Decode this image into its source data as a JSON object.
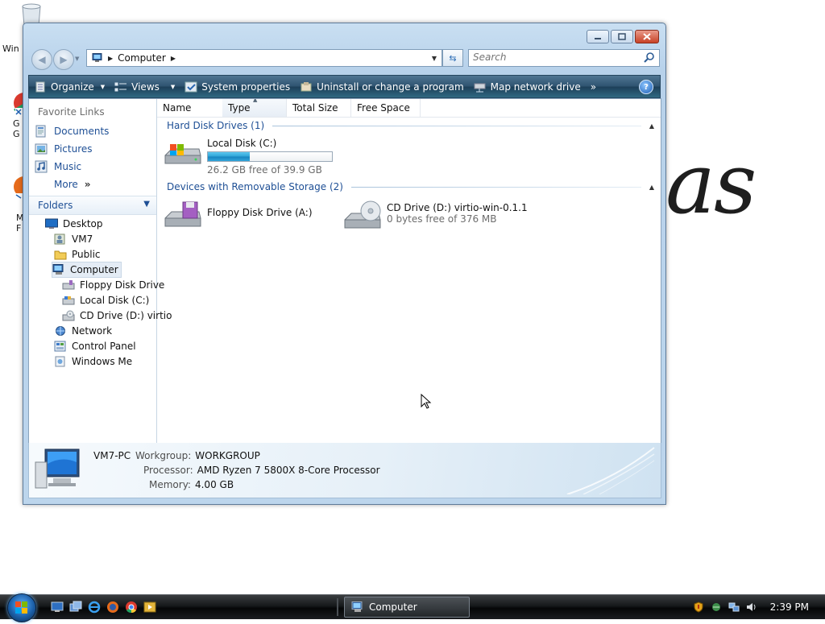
{
  "desktop": {
    "partial_icon_labels": [
      "Win",
      "G",
      "G",
      "M",
      "F"
    ],
    "background_text": "as"
  },
  "window": {
    "title": "Computer",
    "address": {
      "breadcrumb": "Computer"
    },
    "search": {
      "placeholder": "Search"
    },
    "commands": {
      "organize": "Organize",
      "views": "Views",
      "system_properties": "System properties",
      "uninstall": "Uninstall or change a program",
      "map_drive": "Map network drive",
      "more": "»"
    },
    "help": "?"
  },
  "nav_pane": {
    "favorite_links_title": "Favorite Links",
    "favorites": [
      {
        "label": "Documents",
        "icon": "documents-icon"
      },
      {
        "label": "Pictures",
        "icon": "pictures-icon"
      },
      {
        "label": "Music",
        "icon": "music-icon"
      },
      {
        "label": "More",
        "icon": "more-icon"
      }
    ],
    "more_arrows": "»",
    "folders_title": "Folders",
    "tree": [
      {
        "label": "Desktop",
        "icon": "desktop-icon"
      },
      {
        "label": "VM7",
        "icon": "user-folder-icon"
      },
      {
        "label": "Public",
        "icon": "folder-icon"
      },
      {
        "label": "Computer",
        "icon": "computer-icon"
      },
      {
        "label": "Floppy Disk Drive",
        "icon": "floppy-drive-icon"
      },
      {
        "label": "Local Disk (C:)",
        "icon": "hard-disk-icon"
      },
      {
        "label": "CD Drive (D:) virtio",
        "icon": "cd-drive-icon"
      },
      {
        "label": "Network",
        "icon": "network-icon"
      },
      {
        "label": "Control Panel",
        "icon": "control-panel-icon"
      },
      {
        "label": "Windows Me",
        "icon": "windows-meeting-icon"
      }
    ]
  },
  "file_list": {
    "columns": [
      "Name",
      "Type",
      "Total Size",
      "Free Space"
    ],
    "groups": {
      "hard_disks": "Hard Disk Drives (1)",
      "removable": "Devices with Removable Storage (2)"
    },
    "drives": {
      "local_disk": {
        "name": "Local Disk (C:)",
        "info": "26.2 GB free of 39.9 GB",
        "used_fraction": 0.34
      },
      "floppy": {
        "name": "Floppy Disk Drive (A:)"
      },
      "cd": {
        "name": "CD Drive (D:) virtio-win-0.1.1",
        "info": "0 bytes free of 376 MB"
      }
    }
  },
  "details": {
    "computer_name": "VM7-PC",
    "workgroup_label": "Workgroup:",
    "workgroup": "WORKGROUP",
    "processor_label": "Processor:",
    "processor": "AMD Ryzen 7 5800X 8-Core Processor",
    "memory_label": "Memory:",
    "memory": "4.00 GB"
  },
  "taskbar": {
    "active_task": "Computer",
    "clock": "2:39 PM"
  },
  "colors": {
    "link": "#1e4f95",
    "command_bar": "#2f5471",
    "capacity_fill": "#2da3d6"
  }
}
